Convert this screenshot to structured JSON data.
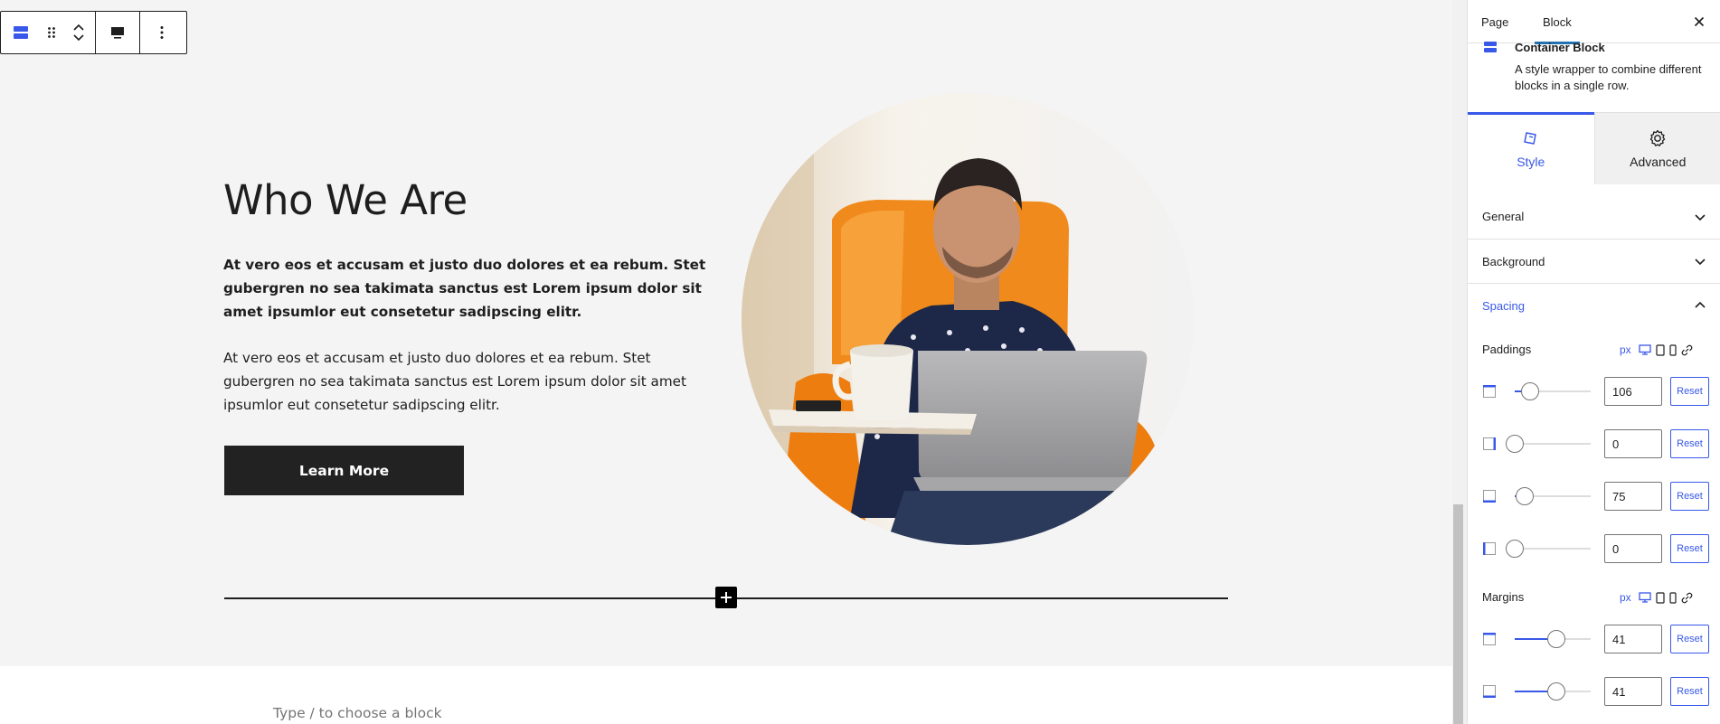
{
  "toolbar": {
    "block_type_icon": "container-block-icon",
    "drag_icon": "drag-handle-icon",
    "move_up_icon": "chevron-up-icon",
    "move_down_icon": "chevron-down-icon",
    "alignment_icon": "align-full-icon",
    "options_icon": "more-vertical-icon"
  },
  "hero": {
    "title": "Who We Are",
    "intro_bold": "At vero eos et accusam et justo duo dolores et ea rebum. Stet gubergren no sea takimata sanctus est Lorem ipsum dolor sit amet ipsumlor eut consetetur sadipscing elitr.",
    "intro_body": "At vero eos et accusam et justo duo dolores et ea rebum. Stet gubergren no sea takimata sanctus est Lorem ipsum dolor sit amet ipsumlor eut consetetur sadipscing elitr.",
    "button_label": "Learn More"
  },
  "editor": {
    "appender_placeholder": "Type / to choose a block"
  },
  "sidebar": {
    "tabs": {
      "page": "Page",
      "block": "Block"
    },
    "block_card": {
      "title": "Container Block",
      "description": "A style wrapper to combine different blocks in a single row."
    },
    "style_tabs": {
      "style": "Style",
      "advanced": "Advanced"
    },
    "panels": {
      "general": "General",
      "background": "Background",
      "spacing": "Spacing"
    },
    "spacing": {
      "paddings_label": "Paddings",
      "margins_label": "Margins",
      "unit": "px",
      "reset_label": "Reset",
      "paddings": [
        {
          "side": "top",
          "value": "106",
          "slider_fraction": 0.2
        },
        {
          "side": "right",
          "value": "0",
          "slider_fraction": 0.0
        },
        {
          "side": "bottom",
          "value": "75",
          "slider_fraction": 0.13
        },
        {
          "side": "left",
          "value": "0",
          "slider_fraction": 0.0
        }
      ],
      "margins": [
        {
          "side": "top",
          "value": "41",
          "slider_fraction": 0.55
        },
        {
          "side": "bottom",
          "value": "41",
          "slider_fraction": 0.55
        }
      ]
    }
  },
  "colors": {
    "accent": "#3858e9",
    "wp_blue": "#2271b1",
    "section_bg": "#f4f4f4",
    "button_bg": "#222222",
    "text": "#1e1e1e"
  }
}
